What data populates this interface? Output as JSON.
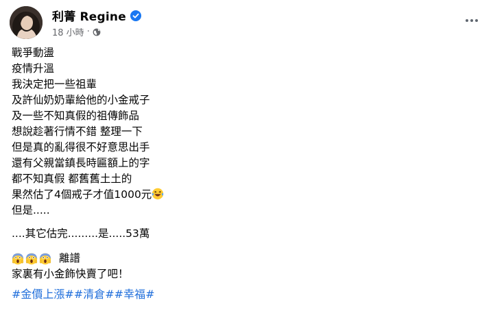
{
  "post": {
    "author": "利菁 Regine",
    "time": "18 小時",
    "separator": "·",
    "lines_block1": [
      "戰爭動盪",
      "疫情升溫",
      "我決定把一些祖輩",
      "及許仙奶奶輩給他的小金戒子",
      "及一些不知真假的祖傳飾品",
      "想說趁著行情不錯 整理一下",
      "但是真的亂得很不好意思出手",
      "還有父親當鎮長時匾額上的字",
      "都不知真假 都舊舊土土的",
      "果然估了4個戒子才值1000元"
    ],
    "line_but": "但是.....",
    "line_estimate": "....其它估完.........是.....53萬",
    "line_ridiculous": "離譜",
    "line_sell": "家裏有小金飾快賣了吧！",
    "hashtags": [
      "#金價上漲#",
      "#清倉#",
      "#幸福#"
    ]
  },
  "icons": {
    "verified": "verified-badge-icon",
    "audience": "globe-icon",
    "more": "more-options-icon",
    "emoji_laugh": "laughing-tears-emoji",
    "emoji_scream": "screaming-face-emoji"
  },
  "colors": {
    "verified": "#1877f2",
    "hashtag": "#216fdb",
    "meta": "#65676b"
  }
}
